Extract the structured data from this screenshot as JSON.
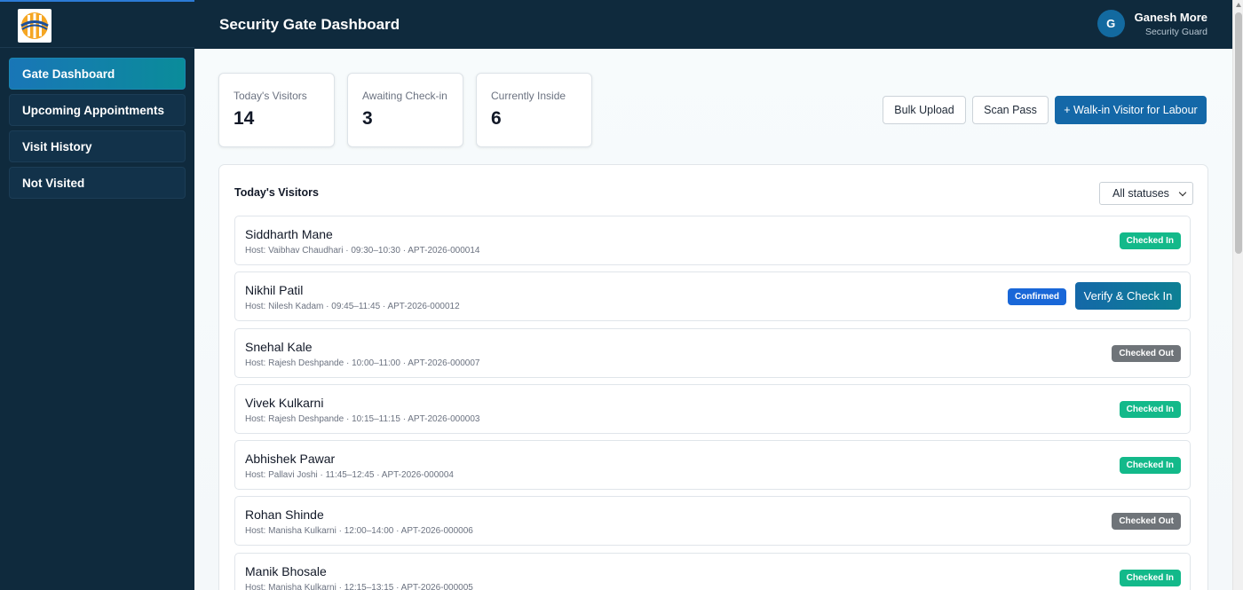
{
  "sidebar": {
    "items": [
      {
        "label": "Gate Dashboard",
        "active": true
      },
      {
        "label": "Upcoming Appointments"
      },
      {
        "label": "Visit History"
      },
      {
        "label": "Not Visited"
      }
    ]
  },
  "header": {
    "title": "Security Gate Dashboard",
    "user": {
      "initial": "G",
      "name": "Ganesh More",
      "role": "Security Guard"
    }
  },
  "stats": [
    {
      "label": "Today's Visitors",
      "value": "14"
    },
    {
      "label": "Awaiting Check-in",
      "value": "3"
    },
    {
      "label": "Currently Inside",
      "value": "6"
    }
  ],
  "actions": {
    "bulk_upload": "Bulk Upload",
    "scan_pass": "Scan Pass",
    "walk_in": "+ Walk-in Visitor for Labour"
  },
  "panel": {
    "title": "Today's Visitors",
    "filter": {
      "selected": "All statuses"
    },
    "verify_label": "Verify & Check In"
  },
  "visitors": [
    {
      "name": "Siddharth Mane",
      "meta": "Host: Vaibhav Chaudhari · 09:30–10:30 · APT-2026-000014",
      "status": "Checked In"
    },
    {
      "name": "Nikhil Patil",
      "meta": "Host: Nilesh Kadam · 09:45–11:45 · APT-2026-000012",
      "status": "Confirmed"
    },
    {
      "name": "Snehal Kale",
      "meta": "Host: Rajesh Deshpande · 10:00–11:00 · APT-2026-000007",
      "status": "Checked Out"
    },
    {
      "name": "Vivek Kulkarni",
      "meta": "Host: Rajesh Deshpande · 10:15–11:15 · APT-2026-000003",
      "status": "Checked In"
    },
    {
      "name": "Abhishek Pawar",
      "meta": "Host: Pallavi Joshi · 11:45–12:45 · APT-2026-000004",
      "status": "Checked In"
    },
    {
      "name": "Rohan Shinde",
      "meta": "Host: Manisha Kulkarni · 12:00–14:00 · APT-2026-000006",
      "status": "Checked Out"
    },
    {
      "name": "Manik Bhosale",
      "meta": "Host: Manisha Kulkarni · 12:15–13:15 · APT-2026-000005",
      "status": "Checked In"
    }
  ],
  "colors": {
    "navy": "#0f2a3d",
    "primary": "#1468a8",
    "checked_in": "#13b98a",
    "checked_out": "#6f7479",
    "confirmed": "#1967d8"
  }
}
